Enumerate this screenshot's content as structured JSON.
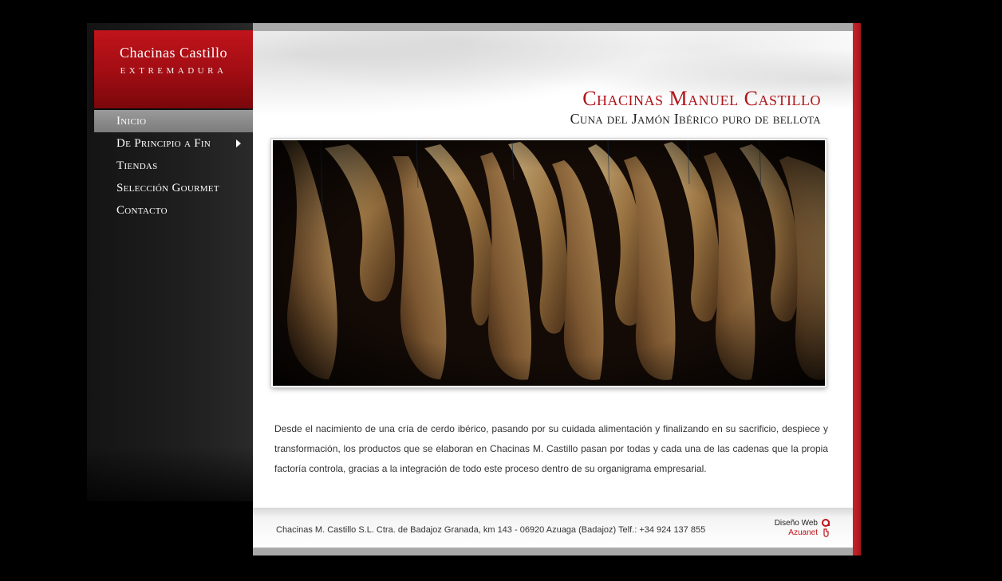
{
  "brand": {
    "title": "Chacinas Castillo",
    "subtitle": "EXTREMADURA"
  },
  "nav": {
    "items": [
      {
        "label": "Inicio",
        "active": true
      },
      {
        "label": "De Principio a Fin",
        "has_submenu": true
      },
      {
        "label": "Tiendas"
      },
      {
        "label": "Selección Gourmet"
      },
      {
        "label": "Contacto"
      }
    ]
  },
  "header": {
    "title": "Chacinas Manuel Castillo",
    "subtitle": "Cuna del Jamón Ibérico puro de bellota"
  },
  "content": {
    "intro": "Desde el nacimiento de una cría de cerdo ibérico, pasando por su cuidada alimentación y finalizando en su sacrificio, despiece y transformación, los productos que se elaboran en Chacinas M. Castillo pasan por todas y cada una de las cadenas que la propia factoría controla, gracias a la integración de todo este proceso dentro de su organigrama empresarial."
  },
  "footer": {
    "address": "Chacinas M. Castillo S.L. Ctra. de Badajoz Granada, km 143 - 06920 Azuaga (Badajoz) Telf.: +34 924 137 855",
    "credit_label": "Diseño Web",
    "credit_name": "Azuanet"
  },
  "colors": {
    "accent": "#b0141a",
    "background": "#000000",
    "sidebar": "#1f1f1f"
  }
}
